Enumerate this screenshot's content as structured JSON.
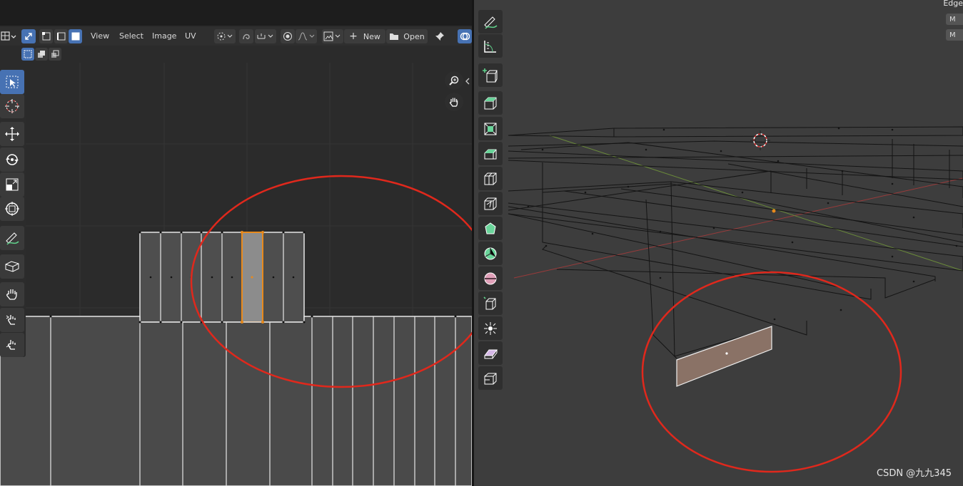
{
  "uv_editor": {
    "menu": {
      "view": "View",
      "select": "Select",
      "image": "Image",
      "uv": "UV"
    },
    "image_new_label": "New",
    "image_open_label": "Open",
    "select_modes": [
      "vertex-select",
      "edge-select",
      "face-select"
    ],
    "tools": [
      "select-box",
      "cursor",
      "move",
      "rotate",
      "scale",
      "transform",
      "annotate",
      "rip-region",
      "grab",
      "relax",
      "pinch"
    ]
  },
  "viewport": {
    "top_right_label": "Edge",
    "overlay_buttons": [
      "M",
      "M"
    ],
    "tools": [
      "annotate",
      "measure",
      "add-cube",
      "extrude",
      "inset",
      "bevel",
      "loop-cut",
      "knife",
      "poly-build",
      "spin",
      "smooth",
      "edge-slide",
      "shrink-fatten",
      "shear",
      "rip"
    ]
  },
  "watermark": "CSDN @九九345",
  "colors": {
    "selection_orange": "#e88a1c",
    "annotation_red": "#e0281c",
    "active_tool_blue": "#4772b3",
    "selected_face_fill": "#8a7266"
  }
}
